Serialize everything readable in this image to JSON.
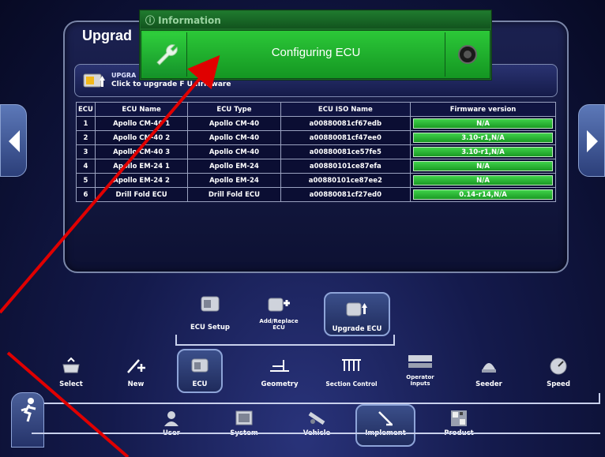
{
  "panel": {
    "title": "Upgrad",
    "upgrade_heading": "UPGRA",
    "upgrade_sub": "Click to upgrade F  U firmware"
  },
  "info_popup": {
    "title": "ⓘ Information",
    "message": "Configuring ECU"
  },
  "table": {
    "headers": [
      "ECU",
      "ECU Name",
      "ECU Type",
      "ECU ISO Name",
      "Firmware version"
    ],
    "rows": [
      {
        "ecu": "1",
        "name": "Apollo CM-40 1",
        "type": "Apollo CM-40",
        "iso": "a00880081cf67edb",
        "fw": "N/A"
      },
      {
        "ecu": "2",
        "name": "Apollo CM-40 2",
        "type": "Apollo CM-40",
        "iso": "a00880081cf47ee0",
        "fw": "3.10-r1,N/A"
      },
      {
        "ecu": "3",
        "name": "Apollo CM-40 3",
        "type": "Apollo CM-40",
        "iso": "a00880081ce57fe5",
        "fw": "3.10-r1,N/A"
      },
      {
        "ecu": "4",
        "name": "Apollo EM-24 1",
        "type": "Apollo EM-24",
        "iso": "a00880101ce87efa",
        "fw": "N/A"
      },
      {
        "ecu": "5",
        "name": "Apollo EM-24 2",
        "type": "Apollo EM-24",
        "iso": "a00880101ce87ee2",
        "fw": "N/A"
      },
      {
        "ecu": "6",
        "name": "Drill Fold ECU",
        "type": "Drill Fold ECU",
        "iso": "a00880081cf27ed0",
        "fw": "0.14-r14,N/A"
      }
    ]
  },
  "ecu_menu": {
    "setup": "ECU Setup",
    "add_replace": "Add/Replace ECU",
    "upgrade": "Upgrade ECU"
  },
  "implement_menu": {
    "select": "Select",
    "new": "New",
    "ecu": "ECU",
    "geometry": "Geometry",
    "section_control": "Section Control",
    "operator_inputs": "Operator Inputs",
    "seeder": "Seeder",
    "speed": "Speed"
  },
  "main_menu": {
    "user": "User",
    "system": "System",
    "vehicle": "Vehicle",
    "implement": "Implement",
    "product": "Product"
  },
  "colors": {
    "accent_green": "#2cc838",
    "annotation_red": "#e00000",
    "panel_border": "#7a86a8"
  }
}
